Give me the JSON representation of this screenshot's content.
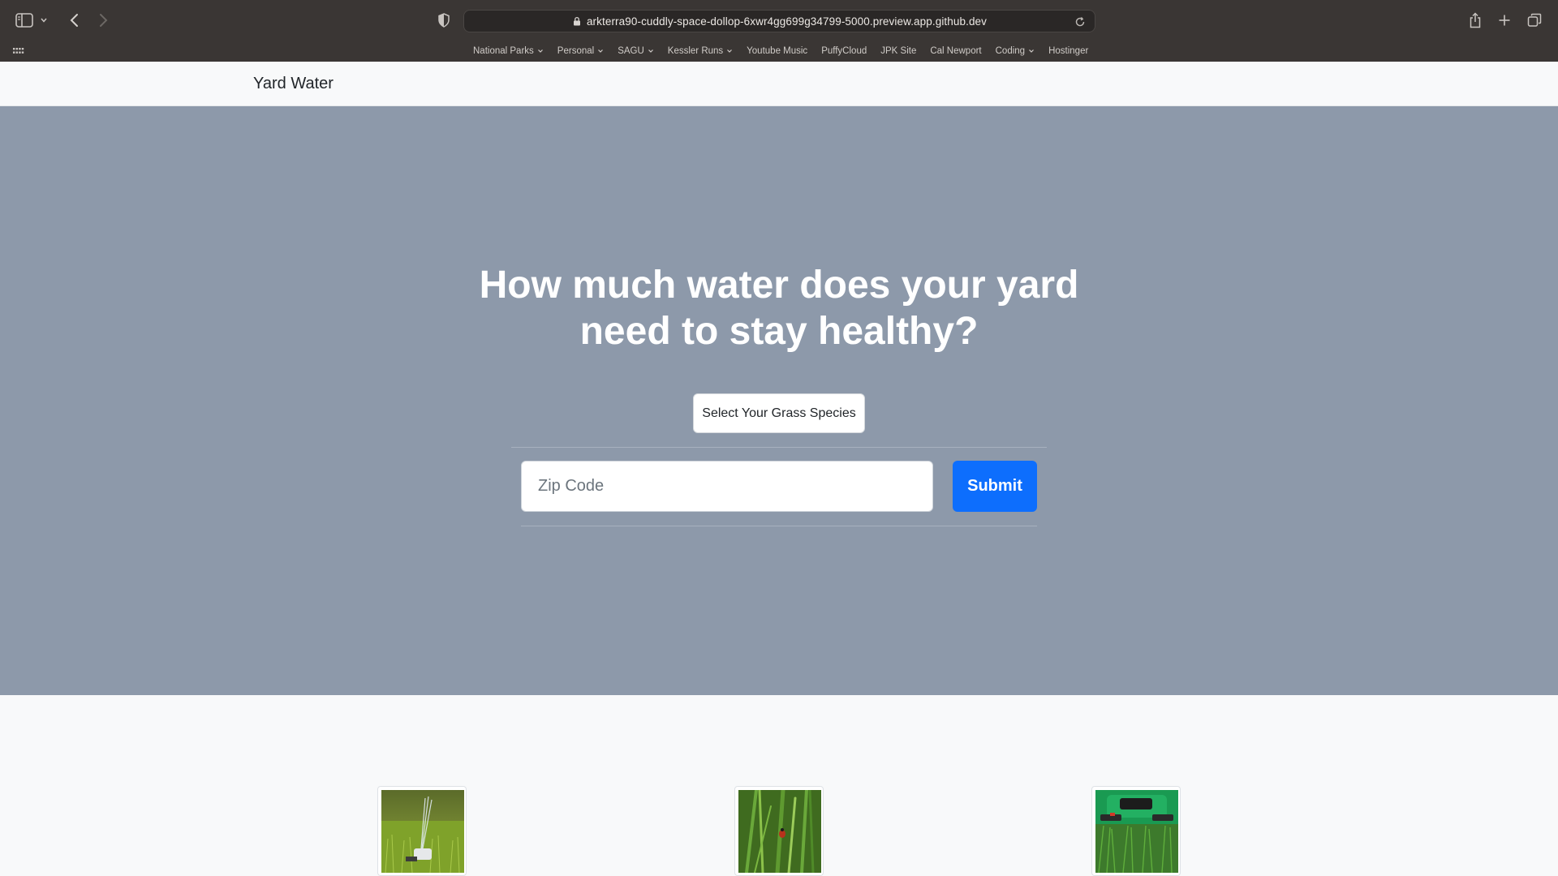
{
  "browser": {
    "url": "arkterra90-cuddly-space-dollop-6xwr4gg699g34799-5000.preview.app.github.dev",
    "icons": [
      "sidebar-icon",
      "chevron-down-icon",
      "back-icon",
      "forward-icon",
      "shield-icon",
      "lock-icon",
      "reload-icon",
      "share-icon",
      "new-tab-icon",
      "tab-overview-icon",
      "apps-grid-icon"
    ],
    "bookmarks": [
      {
        "label": "National Parks",
        "folder": true
      },
      {
        "label": "Personal",
        "folder": true
      },
      {
        "label": "SAGU",
        "folder": true
      },
      {
        "label": "Kessler Runs",
        "folder": true
      },
      {
        "label": "Youtube Music",
        "folder": false
      },
      {
        "label": "PuffyCloud",
        "folder": false
      },
      {
        "label": "JPK Site",
        "folder": false
      },
      {
        "label": "Cal Newport",
        "folder": false
      },
      {
        "label": "Coding",
        "folder": true
      },
      {
        "label": "Hostinger",
        "folder": false
      }
    ]
  },
  "navbar": {
    "brand": "Yard Water"
  },
  "hero": {
    "title": "How much water does your yard need to stay healthy?",
    "species_button": "Select Your Grass Species",
    "zip_placeholder": "Zip Code",
    "submit_label": "Submit",
    "background": "#8d99aa",
    "accent": "#0d6efd"
  },
  "features": {
    "images": [
      {
        "name": "sprinkler-image"
      },
      {
        "name": "grass-ladybug-image"
      },
      {
        "name": "lawn-mower-image"
      }
    ]
  }
}
